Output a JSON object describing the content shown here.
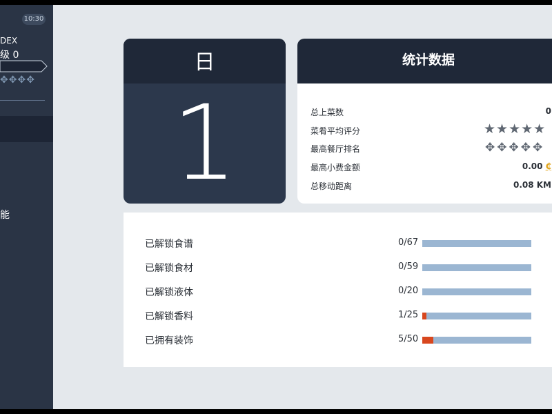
{
  "sidebar": {
    "time": "10:30",
    "dex_label": "DEX",
    "level_label": "级 0",
    "deco": "✥✥✥✥",
    "menu_item_text": "能"
  },
  "day_card": {
    "header": "日",
    "number": "1"
  },
  "stats": {
    "title": "统计数据",
    "rows": [
      {
        "label": "总上菜数",
        "value": "0"
      },
      {
        "label": "菜肴平均评分",
        "value": "★★★★★"
      },
      {
        "label": "最高餐厅排名",
        "value": "✥✥✥✥✥"
      },
      {
        "label": "最高小费金额",
        "value": "0.00",
        "icon": "coin-icon",
        "currency_glyph": "₵"
      },
      {
        "label": "总移动距离",
        "value": "0.08 KM"
      }
    ]
  },
  "unlocks": [
    {
      "label": "已解锁食谱",
      "count": "0/67",
      "progress": 0
    },
    {
      "label": "已解锁食材",
      "count": "0/59",
      "progress": 0
    },
    {
      "label": "已解锁液体",
      "count": "0/20",
      "progress": 0
    },
    {
      "label": "已解锁香料",
      "count": "1/25",
      "progress": 0.04
    },
    {
      "label": "已拥有装饰",
      "count": "5/50",
      "progress": 0.1
    }
  ],
  "colors": {
    "sidebar_bg": "#2a3445",
    "card_header_bg": "#1f2838",
    "progress_track": "#9bb6d2",
    "progress_fill": "#d8471e",
    "coin": "#e0a216"
  }
}
